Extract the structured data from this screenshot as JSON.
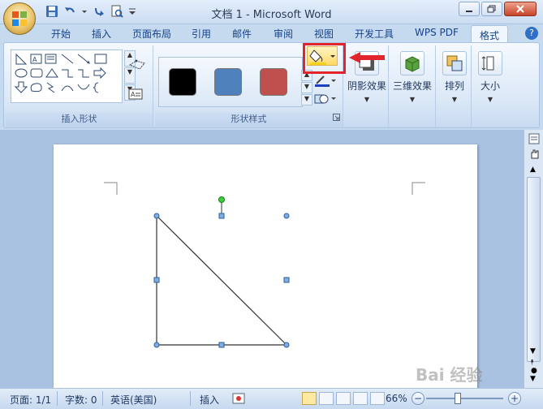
{
  "window": {
    "title": "文档 1 - Microsoft Word"
  },
  "tabs": [
    {
      "label": "开始"
    },
    {
      "label": "插入"
    },
    {
      "label": "页面布局"
    },
    {
      "label": "引用"
    },
    {
      "label": "邮件"
    },
    {
      "label": "审阅"
    },
    {
      "label": "视图"
    },
    {
      "label": "开发工具"
    },
    {
      "label": "WPS PDF"
    },
    {
      "label": "格式",
      "active": true
    }
  ],
  "ribbon": {
    "insert_shapes_label": "插入形状",
    "shape_styles_label": "形状样式",
    "swatch_colors": [
      "#000000",
      "#4f81bd",
      "#c0504d"
    ],
    "shadow_effects_label": "阴影效果",
    "threed_effects_label": "三维效果",
    "arrange_label": "排列",
    "size_label": "大小"
  },
  "statusbar": {
    "page": "页面: 1/1",
    "words": "字数: 0",
    "language": "英语(美国)",
    "mode": "插入",
    "zoom": "66%"
  },
  "watermark": "Bai 经验"
}
